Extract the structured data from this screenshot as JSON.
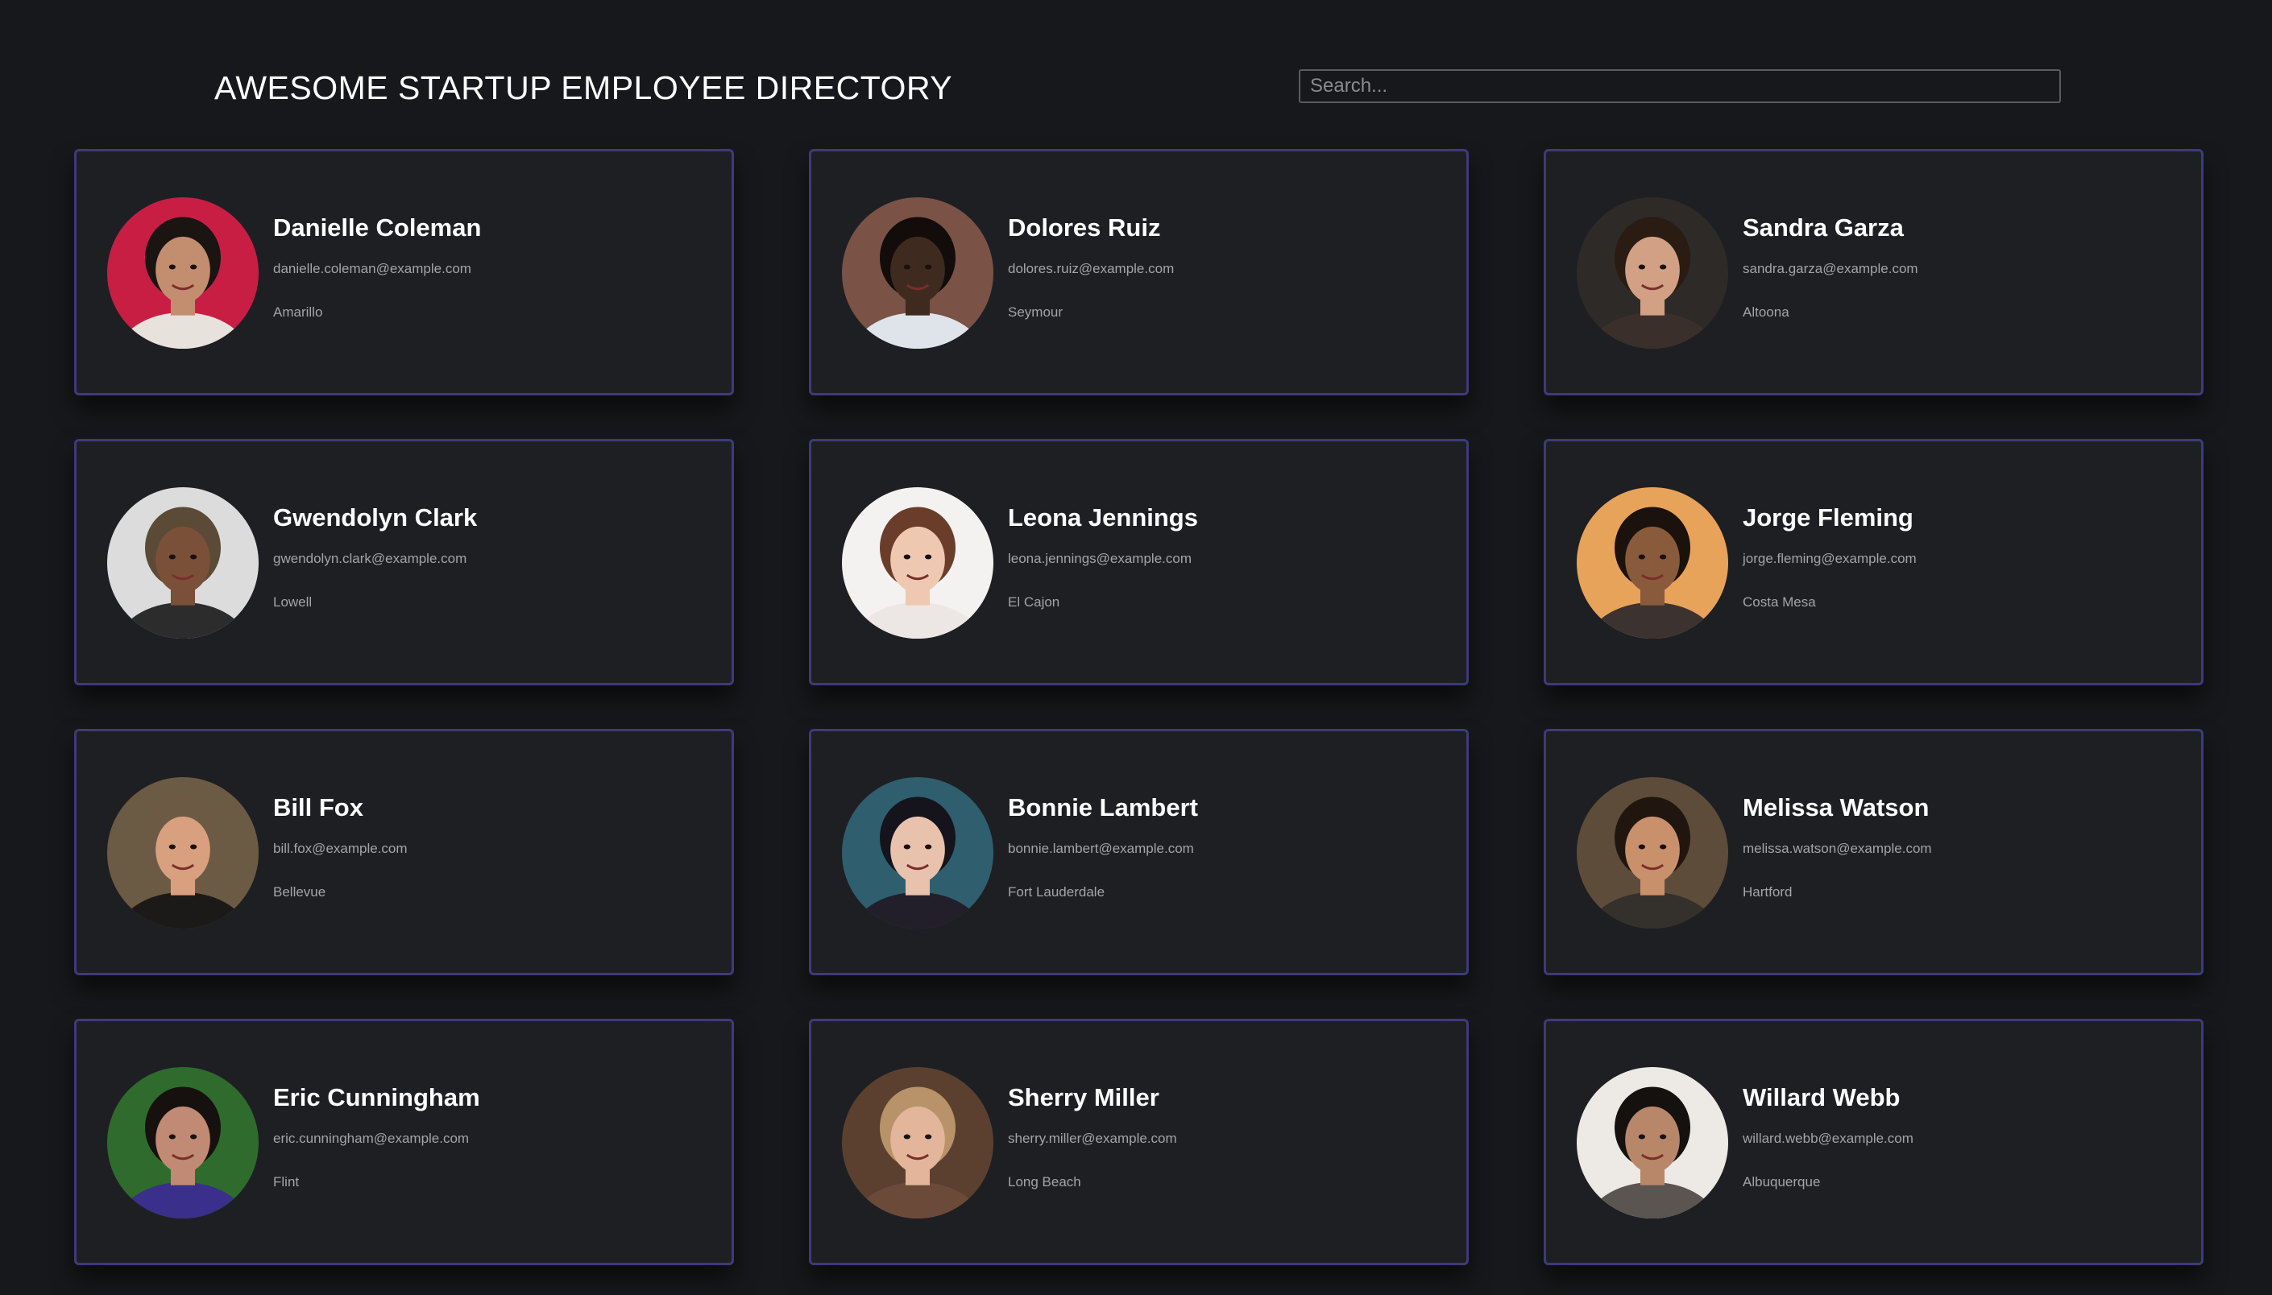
{
  "header": {
    "title": "AWESOME STARTUP EMPLOYEE DIRECTORY",
    "search_placeholder": "Search..."
  },
  "employees": [
    {
      "name": "Danielle Coleman",
      "email": "danielle.coleman@example.com",
      "city": "Amarillo",
      "bg": "#c81e44",
      "skin": "#c28e6f",
      "hair": "#1a1412",
      "shirt": "#e8e2dc"
    },
    {
      "name": "Dolores Ruiz",
      "email": "dolores.ruiz@example.com",
      "city": "Seymour",
      "bg": "#7a5246",
      "skin": "#3f2a20",
      "hair": "#120c0a",
      "shirt": "#dfe4ea"
    },
    {
      "name": "Sandra Garza",
      "email": "sandra.garza@example.com",
      "city": "Altoona",
      "bg": "#2e2a27",
      "skin": "#d2a084",
      "hair": "#2a1b13",
      "shirt": "#3a2f2a"
    },
    {
      "name": "Gwendolyn Clark",
      "email": "gwendolyn.clark@example.com",
      "city": "Lowell",
      "bg": "#dcdcdc",
      "skin": "#7a5038",
      "hair": "#5b4a36",
      "shirt": "#2c2c2c"
    },
    {
      "name": "Leona Jennings",
      "email": "leona.jennings@example.com",
      "city": "El Cajon",
      "bg": "#f4f2f1",
      "skin": "#efc8b2",
      "hair": "#6a3d2a",
      "shirt": "#ece7e4"
    },
    {
      "name": "Jorge Fleming",
      "email": "jorge.fleming@example.com",
      "city": "Costa Mesa",
      "bg": "#e8a35a",
      "skin": "#8a5a3c",
      "hair": "#1b120d",
      "shirt": "#3c3330"
    },
    {
      "name": "Bill Fox",
      "email": "bill.fox@example.com",
      "city": "Bellevue",
      "bg": "#6b5a44",
      "skin": "#d8a07e",
      "hair": "#6d5a44",
      "shirt": "#1c1a18"
    },
    {
      "name": "Bonnie Lambert",
      "email": "bonnie.lambert@example.com",
      "city": "Fort Lauderdale",
      "bg": "#2f5e6e",
      "skin": "#e8c2ad",
      "hair": "#15131c",
      "shirt": "#221f2a"
    },
    {
      "name": "Melissa Watson",
      "email": "melissa.watson@example.com",
      "city": "Hartford",
      "bg": "#5e4c3a",
      "skin": "#c9906c",
      "hair": "#21160f",
      "shirt": "#34302c"
    },
    {
      "name": "Eric Cunningham",
      "email": "eric.cunningham@example.com",
      "city": "Flint",
      "bg": "#2f6b2d",
      "skin": "#c08a74",
      "hair": "#16110f",
      "shirt": "#3a2f8a"
    },
    {
      "name": "Sherry Miller",
      "email": "sherry.miller@example.com",
      "city": "Long Beach",
      "bg": "#5b4030",
      "skin": "#e3b59a",
      "hair": "#b89268",
      "shirt": "#6c4a3a"
    },
    {
      "name": "Willard Webb",
      "email": "willard.webb@example.com",
      "city": "Albuquerque",
      "bg": "#ede9e4",
      "skin": "#b8876a",
      "hair": "#15110e",
      "shirt": "#5a5550"
    }
  ]
}
